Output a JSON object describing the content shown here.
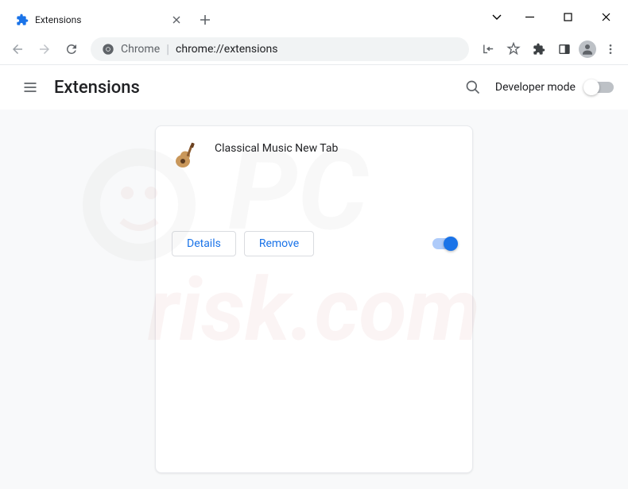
{
  "window": {
    "tab_title": "Extensions"
  },
  "omnibox": {
    "prefix": "Chrome",
    "url": "chrome://extensions"
  },
  "page": {
    "title": "Extensions",
    "dev_mode_label": "Developer mode"
  },
  "extension": {
    "name": "Classical Music New Tab",
    "details_label": "Details",
    "remove_label": "Remove",
    "enabled": true
  }
}
